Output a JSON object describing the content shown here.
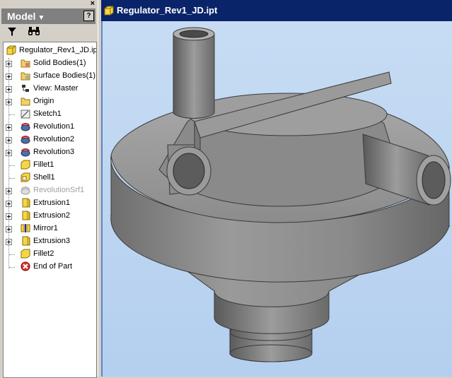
{
  "browser": {
    "close_symbol": "×",
    "title": "Model",
    "title_arrow": "▼",
    "help_symbol": "?",
    "tools": {
      "filter_icon": "filter-icon",
      "find_icon": "binoculars-icon"
    }
  },
  "tree": {
    "root": {
      "label": "Regulator_Rev1_JD.ipt",
      "icon": "part-icon"
    },
    "items": [
      {
        "label": "Solid Bodies(1)",
        "icon": "solid-bodies-folder-icon",
        "expandable": true,
        "disabled": false
      },
      {
        "label": "Surface Bodies(1)",
        "icon": "surface-bodies-folder-icon",
        "expandable": true,
        "disabled": false
      },
      {
        "label": "View: Master",
        "icon": "view-icon",
        "expandable": true,
        "disabled": false
      },
      {
        "label": "Origin",
        "icon": "origin-folder-icon",
        "expandable": true,
        "disabled": false
      },
      {
        "label": "Sketch1",
        "icon": "sketch-icon",
        "expandable": false,
        "disabled": false
      },
      {
        "label": "Revolution1",
        "icon": "revolution-icon",
        "expandable": true,
        "disabled": false
      },
      {
        "label": "Revolution2",
        "icon": "revolution-icon",
        "expandable": true,
        "disabled": false
      },
      {
        "label": "Revolution3",
        "icon": "revolution-icon",
        "expandable": true,
        "disabled": false
      },
      {
        "label": "Fillet1",
        "icon": "fillet-icon",
        "expandable": false,
        "disabled": false
      },
      {
        "label": "Shell1",
        "icon": "shell-icon",
        "expandable": false,
        "disabled": false
      },
      {
        "label": "RevolutionSrf1",
        "icon": "revolution-surface-icon",
        "expandable": true,
        "disabled": true
      },
      {
        "label": "Extrusion1",
        "icon": "extrusion-icon",
        "expandable": true,
        "disabled": false
      },
      {
        "label": "Extrusion2",
        "icon": "extrusion-icon",
        "expandable": true,
        "disabled": false
      },
      {
        "label": "Mirror1",
        "icon": "mirror-icon",
        "expandable": true,
        "disabled": false
      },
      {
        "label": "Extrusion3",
        "icon": "extrusion-icon",
        "expandable": true,
        "disabled": false
      },
      {
        "label": "Fillet2",
        "icon": "fillet-icon",
        "expandable": false,
        "disabled": false
      },
      {
        "label": "End of Part",
        "icon": "end-of-part-icon",
        "expandable": false,
        "disabled": false
      }
    ]
  },
  "document": {
    "title": "Regulator_Rev1_JD.ipt",
    "icon": "part-icon",
    "viewport_model": "regulator-model"
  },
  "colors": {
    "title_bar": "#0a246a",
    "viewport_bg": "#c0d8f2",
    "model_gray": "#7f7f7f",
    "panel_header": "#808080"
  }
}
